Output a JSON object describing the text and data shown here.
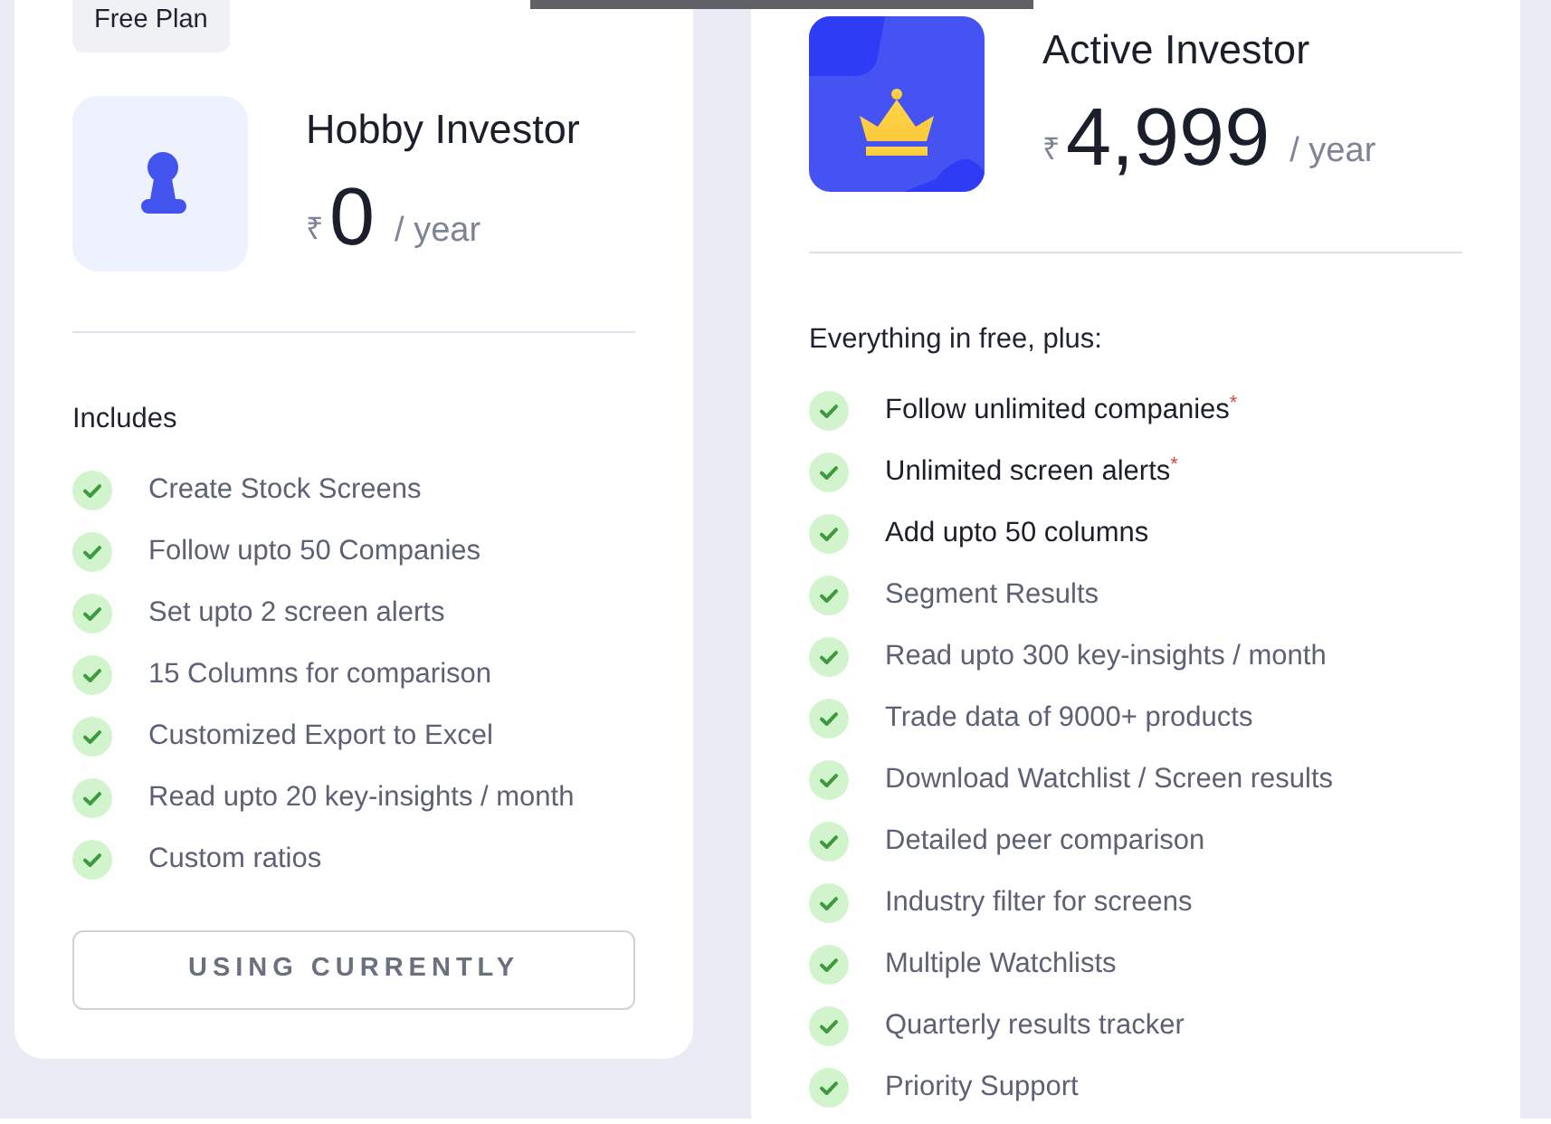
{
  "plans": [
    {
      "kind": "free",
      "badge": "Free Plan",
      "name": "Hobby Investor",
      "currency": "₹",
      "price": "0",
      "period": "/ year",
      "features_title": "Includes",
      "features": [
        {
          "text": "Create Stock Screens",
          "emphasized": false
        },
        {
          "text": "Follow upto 50 Companies",
          "emphasized": false
        },
        {
          "text": "Set upto 2 screen alerts",
          "emphasized": false
        },
        {
          "text": "15 Columns for comparison",
          "emphasized": false
        },
        {
          "text": "Customized Export to Excel",
          "emphasized": false
        },
        {
          "text": "Read upto 20 key-insights / month",
          "emphasized": false
        },
        {
          "text": "Custom ratios",
          "emphasized": false
        }
      ],
      "button": "USING CURRENTLY"
    },
    {
      "kind": "premium",
      "name": "Active Investor",
      "currency": "₹",
      "price": "4,999",
      "period": "/ year",
      "features_title": "Everything in free, plus:",
      "features": [
        {
          "text": "Follow unlimited companies$^{*}$",
          "emphasized": true
        },
        {
          "text": "Unlimited screen alerts$^{*}$",
          "emphasized": true
        },
        {
          "text": "Add upto 50 columns",
          "emphasized": true
        },
        {
          "text": "Segment Results",
          "emphasized": false
        },
        {
          "text": "Read upto 300 key-insights / month",
          "emphasized": false
        },
        {
          "text": "Trade data of 9000+ products",
          "emphasized": false
        },
        {
          "text": "Download Watchlist / Screen results",
          "emphasized": false
        },
        {
          "text": "Detailed peer comparison",
          "emphasized": false
        },
        {
          "text": "Industry filter for screens",
          "emphasized": false
        },
        {
          "text": "Multiple Watchlists",
          "emphasized": false
        },
        {
          "text": "Quarterly results tracker",
          "emphasized": false
        },
        {
          "text": "Priority Support",
          "emphasized": false
        }
      ]
    }
  ]
}
